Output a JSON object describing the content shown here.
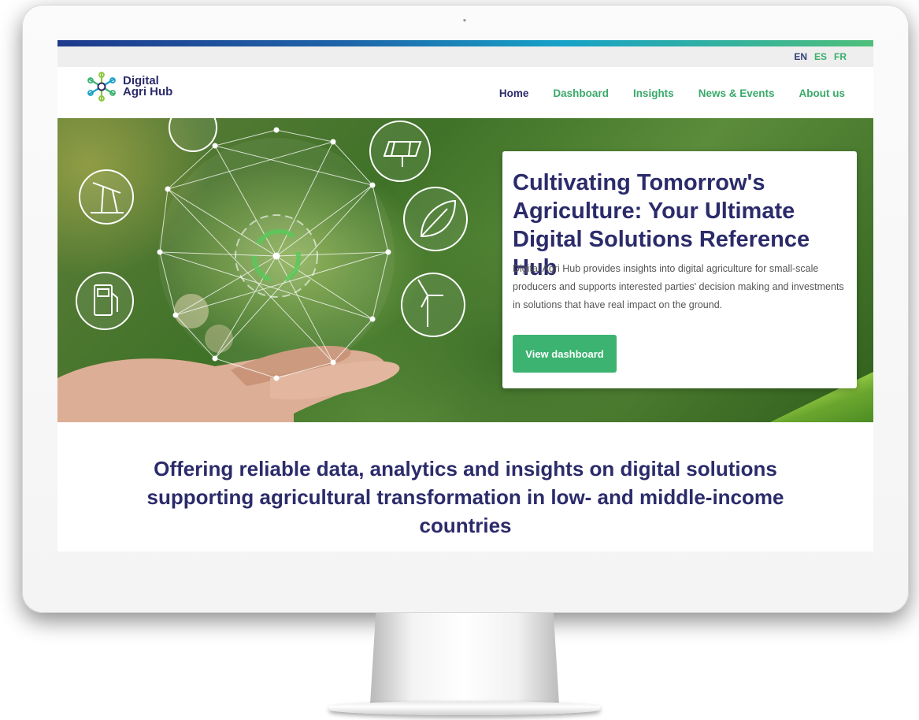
{
  "languages": [
    "EN",
    "ES",
    "FR"
  ],
  "logo": {
    "line1": "Digital",
    "line2": "Agri Hub"
  },
  "nav": [
    {
      "label": "Home",
      "active": true
    },
    {
      "label": "Dashboard"
    },
    {
      "label": "Insights"
    },
    {
      "label": "News & Events"
    },
    {
      "label": "About us"
    }
  ],
  "hero": {
    "title": "Cultivating Tomorrow's Agriculture: Your Ultimate Digital Solutions Reference Hub",
    "description": "Digital Agri Hub provides insights into digital agriculture for small-scale producers and supports interested parties' decision making and investments in solutions that have real impact on the ground.",
    "cta": "View dashboard",
    "icons": [
      "wind-turbine-icon",
      "solar-panel-icon",
      "oil-pump-icon",
      "leaf-icon",
      "fuel-pump-icon",
      "recycle-icon"
    ]
  },
  "tagline": "Offering reliable data, analytics and insights on digital solutions supporting agricultural transformation in low- and middle-income countries",
  "colors": {
    "navy": "#2b2b6b",
    "green": "#3cb371",
    "stripe_start": "#1e3a8c",
    "stripe_end": "#4fbf7a"
  }
}
